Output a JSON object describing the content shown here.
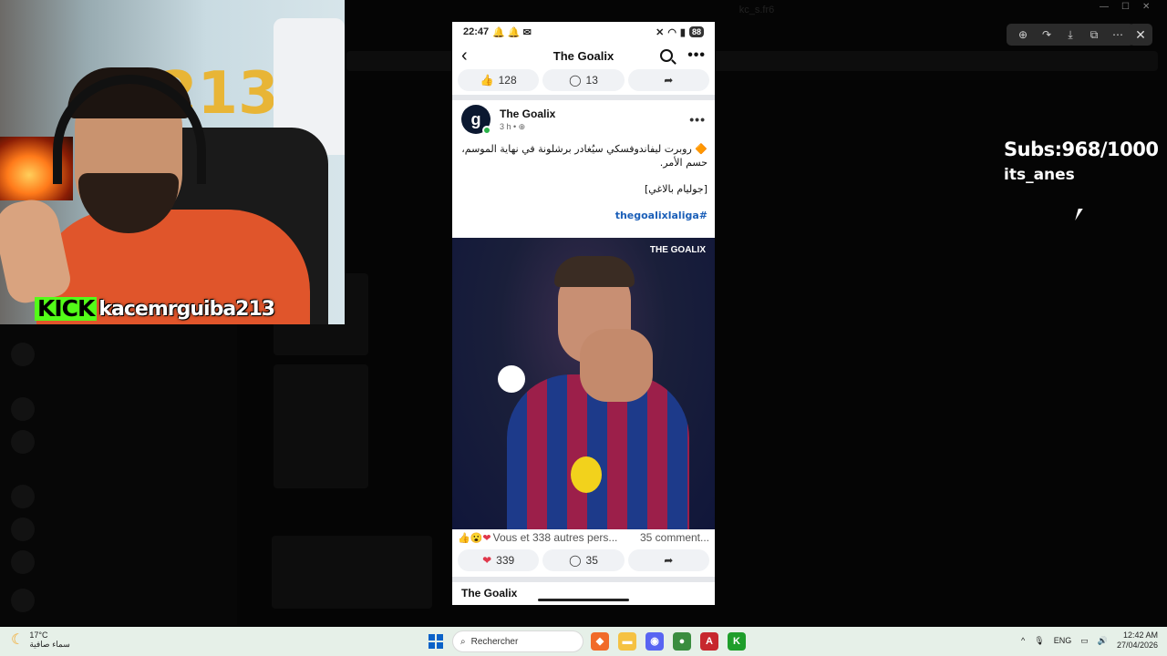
{
  "background_app": {
    "title": "kc_s.fr6"
  },
  "viewer": {
    "tools": [
      "zoom-in-icon",
      "rotate-icon",
      "download-icon",
      "share-icon",
      "more-icon"
    ],
    "close": "✕"
  },
  "overlay": {
    "subs": "Subs:968/1000",
    "handle": "its_anes"
  },
  "webcam": {
    "platform": "KICK",
    "channel": "kacemrguiba213",
    "balloon_digits": "213"
  },
  "phone": {
    "status": {
      "time": "22:47",
      "battery": "88"
    },
    "header": {
      "title": "The Goalix"
    },
    "prev_post_actions": {
      "likes": "128",
      "comments": "13"
    },
    "post": {
      "author": "The Goalix",
      "time": "3 h",
      "text_line1": "🔶 روبرت ليفاندوفسكي سيُغادر برشلونة في نهاية الموسم،",
      "text_line2": "حسم الأمر.",
      "source": "[جوليام بالاغي]",
      "hashtag": "#thegoalixlaliga",
      "image_brand": "THE GOALIX",
      "reactions_text": "Vous et 338 autres pers...",
      "comments_text": "35 comment...",
      "likes": "339",
      "comments": "35"
    },
    "next_post_author": "The Goalix"
  },
  "taskbar": {
    "weather_temp": "17°C",
    "weather_desc": "سماء صافية",
    "search_placeholder": "Rechercher",
    "lang": "ENG",
    "time": "12:42 AM",
    "date": "27/04/2026"
  }
}
